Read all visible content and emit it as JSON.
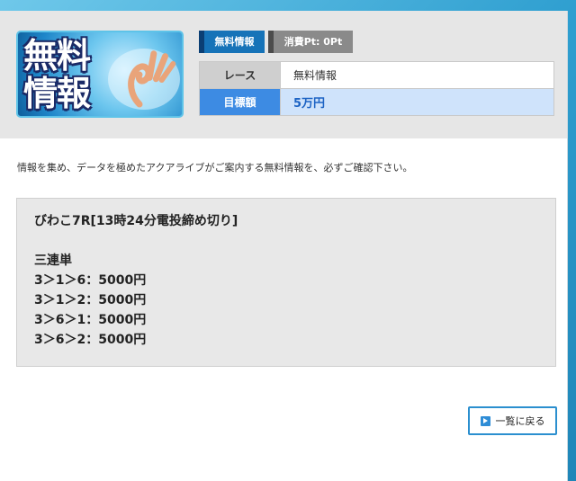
{
  "banner": {
    "line1": "無料",
    "line2": "情報"
  },
  "tags": {
    "free": "無料情報",
    "points": "消費Pt: 0Pt"
  },
  "info": {
    "rows": [
      {
        "key": "レース",
        "value": "無料情報"
      },
      {
        "key": "目標額",
        "value": "5万円"
      }
    ]
  },
  "intro": "情報を集め、データを極めたアクアライブがご案内する無料情報を、必ずご確認下さい。",
  "pick": {
    "title": "びわこ7R[13時24分電投締め切り]",
    "bet_type": "三連単",
    "lines": [
      "3＞1＞6：5000円",
      "3＞1＞2：5000円",
      "3＞6＞1：5000円",
      "3＞6＞2：5000円"
    ]
  },
  "back_button": {
    "label": "一覧に戻る"
  },
  "colors": {
    "accent": "#3d8be3",
    "tag_free": "#1673b8",
    "frame": "#2aa0cf"
  },
  "icons": {
    "back": "arrow-right-icon"
  }
}
